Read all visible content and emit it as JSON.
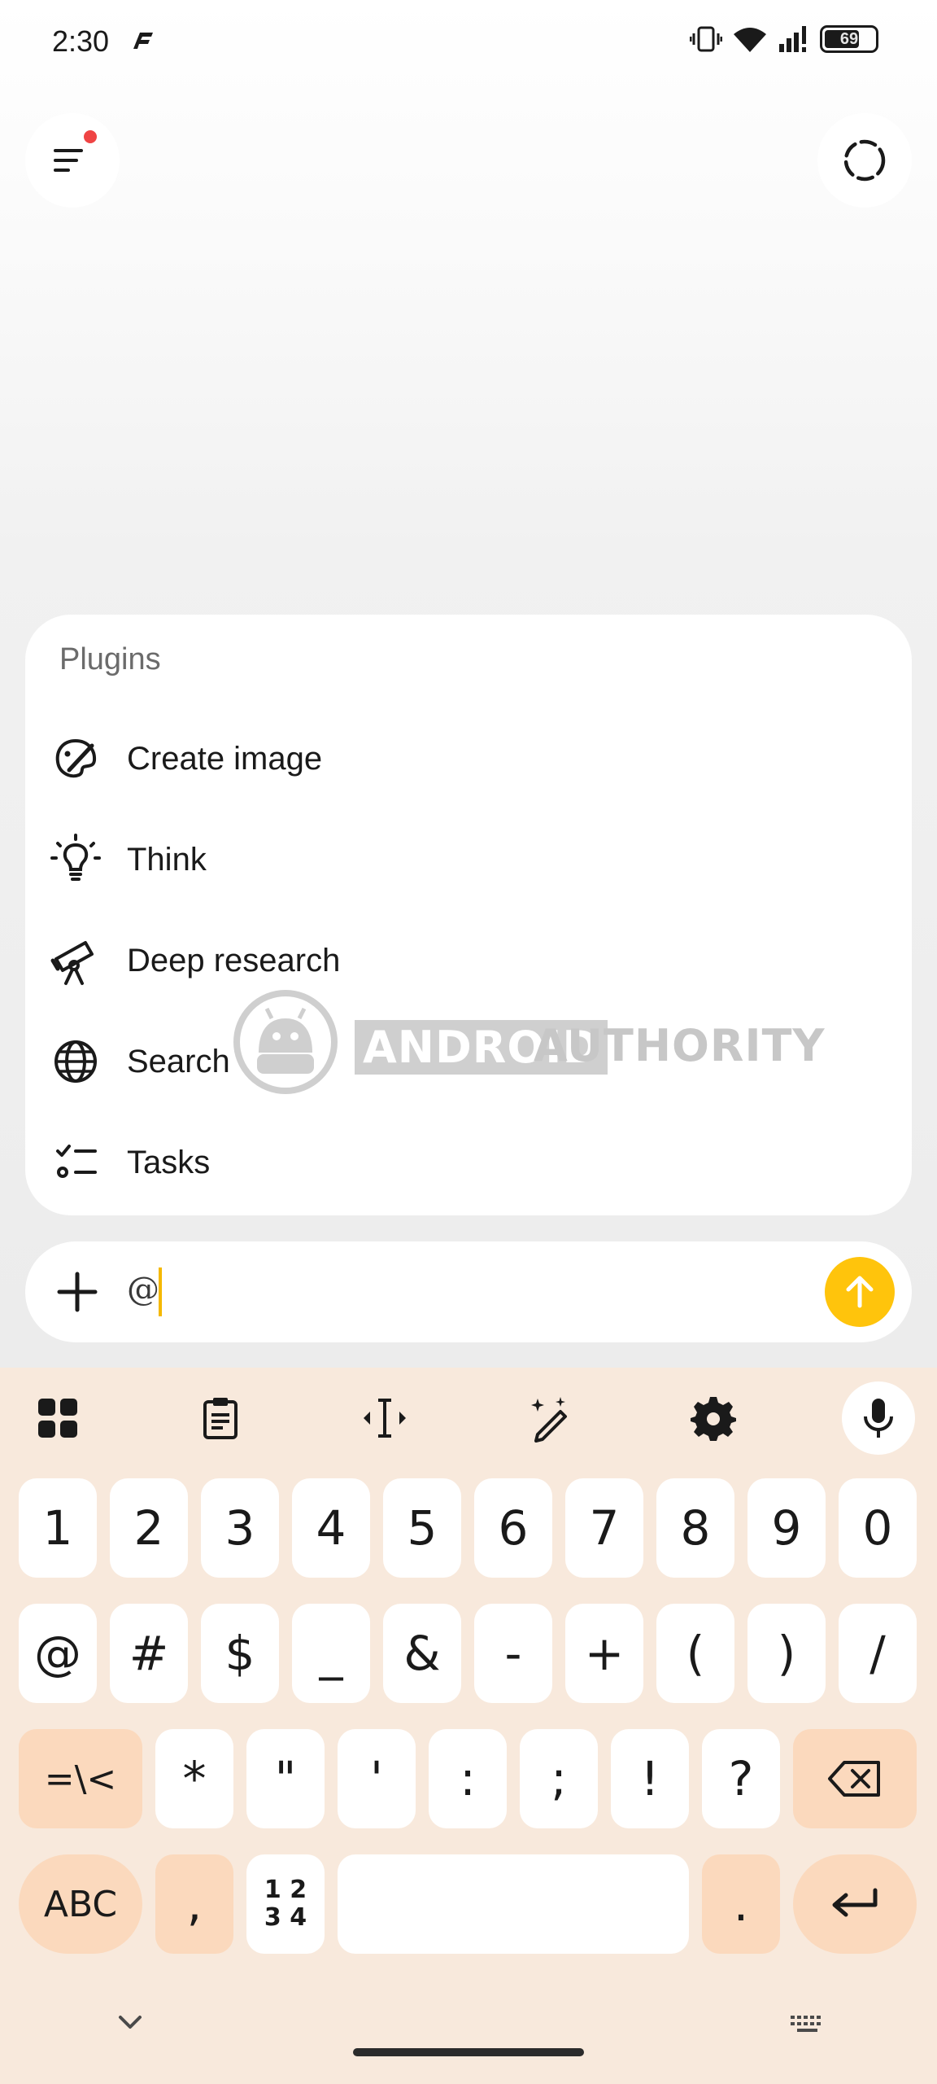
{
  "status_bar": {
    "time": "2:30",
    "battery": "69"
  },
  "plugins": {
    "heading": "Plugins",
    "items": [
      {
        "label": "Create image",
        "icon": "palette-icon"
      },
      {
        "label": "Think",
        "icon": "lightbulb-icon"
      },
      {
        "label": "Deep research",
        "icon": "telescope-icon"
      },
      {
        "label": "Search",
        "icon": "globe-icon"
      },
      {
        "label": "Tasks",
        "icon": "checklist-icon"
      }
    ]
  },
  "watermark": {
    "word1": "ANDROID",
    "word2": "AUTHORITY"
  },
  "composer": {
    "value": "@",
    "send_color": "#ffc40c"
  },
  "keyboard": {
    "toolbar": [
      "apps-grid-icon",
      "clipboard-icon",
      "text-cursor-icon",
      "magic-pen-icon",
      "settings-gear-icon",
      "microphone-icon"
    ],
    "row1": [
      "1",
      "2",
      "3",
      "4",
      "5",
      "6",
      "7",
      "8",
      "9",
      "0"
    ],
    "row2": [
      "@",
      "#",
      "$",
      "_",
      "&",
      "-",
      "+",
      "(",
      ")",
      "/"
    ],
    "row3": [
      "=\\<",
      "*",
      "\"",
      "'",
      ":",
      ";",
      "!",
      "?"
    ],
    "row4": {
      "abc": "ABC",
      "comma": ",",
      "numpad": "1 2\n3 4",
      "period": "."
    },
    "accent_color": "#fbd9bd",
    "background_color": "#f8e9dc"
  }
}
